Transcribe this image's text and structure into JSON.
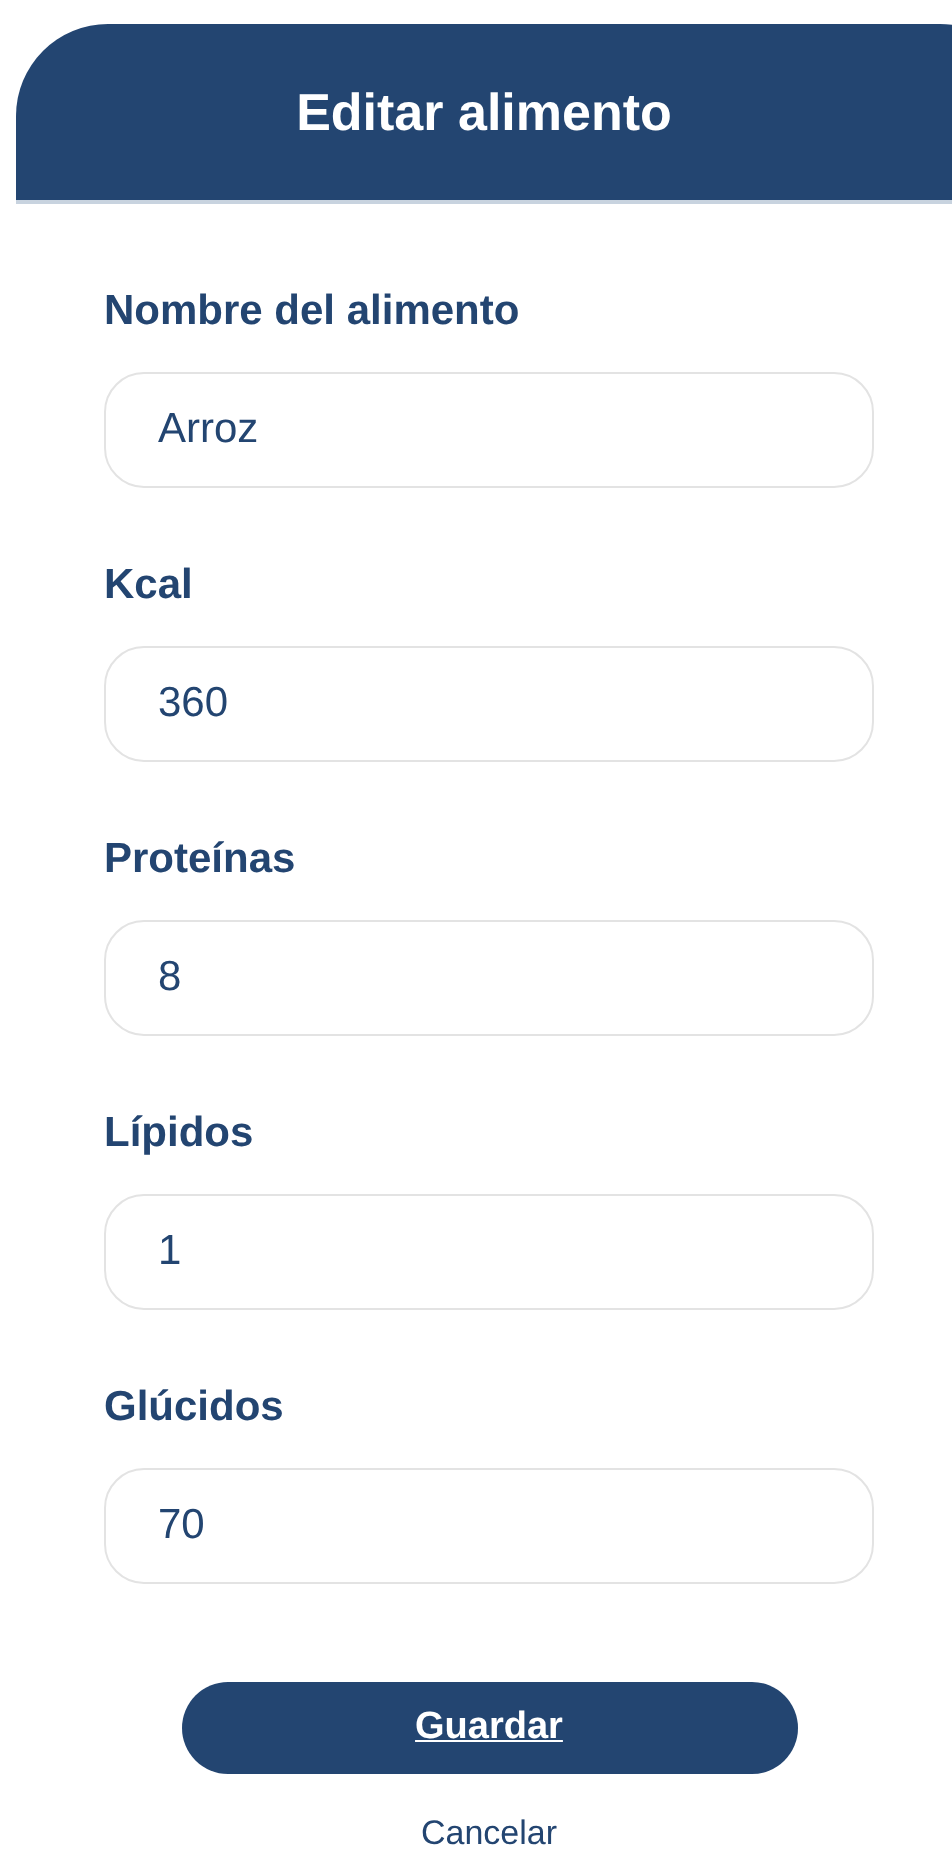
{
  "header": {
    "title": "Editar alimento"
  },
  "fields": [
    {
      "label": "Nombre del alimento",
      "value": "Arroz"
    },
    {
      "label": "Kcal",
      "value": "360"
    },
    {
      "label": "Proteínas",
      "value": "8"
    },
    {
      "label": "Lípidos",
      "value": "1"
    },
    {
      "label": "Glúcidos",
      "value": "70"
    }
  ],
  "buttons": {
    "save": "Guardar",
    "cancel": "Cancelar"
  }
}
